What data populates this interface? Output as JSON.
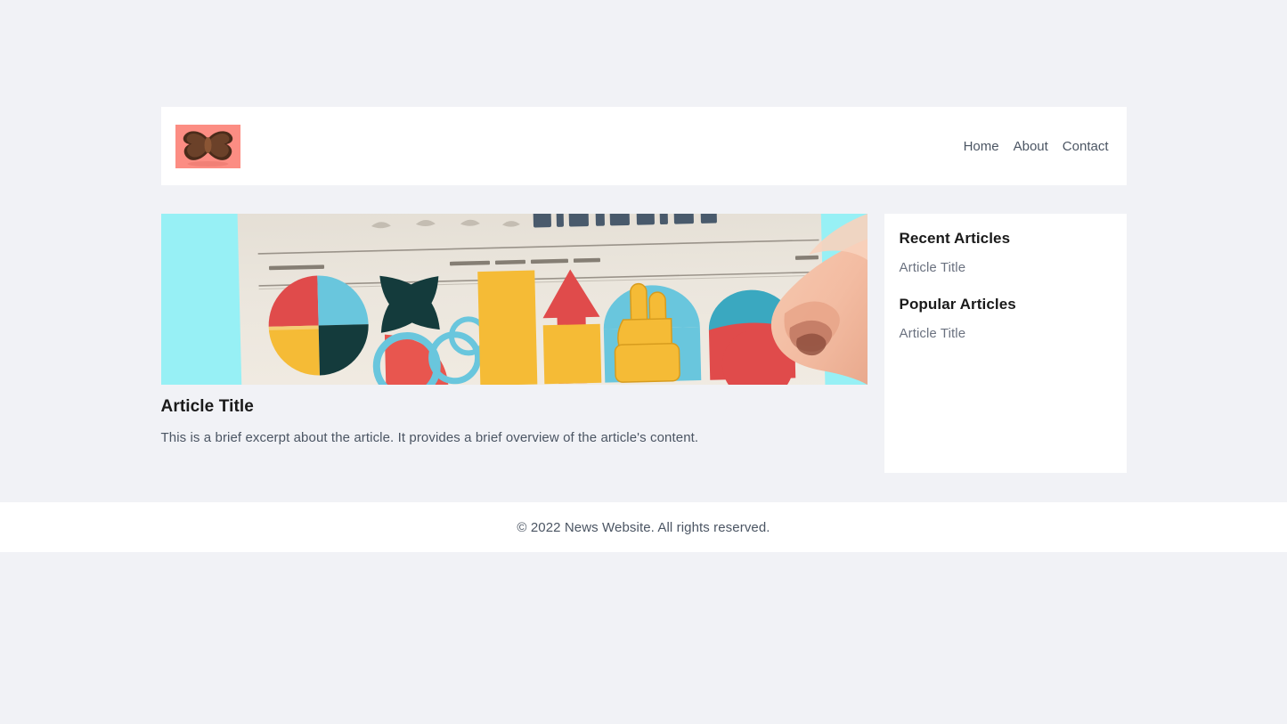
{
  "colors": {
    "page_background": "#f1f2f6",
    "surface": "#ffffff",
    "logo_background": "#fc8d83",
    "logo_mark": "#5a3522",
    "muted_text": "#4b5563",
    "sidebar_link": "#6b7280",
    "heading_text": "#1a1a1a",
    "hero_cyan": "#97f0f5"
  },
  "header": {
    "logo": {
      "icon": "butterfly-logo-icon",
      "alt": "News Website Logo"
    },
    "nav": [
      {
        "label": "Home",
        "name": "nav-link-home"
      },
      {
        "label": "About",
        "name": "nav-link-about"
      },
      {
        "label": "Contact",
        "name": "nav-link-contact"
      }
    ]
  },
  "main": {
    "featured_article": {
      "image_alt": "Hands holding a newspaper with colorful geometric shapes",
      "title": "Article Title",
      "excerpt": "This is a brief excerpt about the article. It provides a brief overview of the article's content."
    }
  },
  "sidebar": {
    "sections": [
      {
        "heading": "Recent Articles",
        "items": [
          {
            "label": "Article Title"
          }
        ]
      },
      {
        "heading": "Popular Articles",
        "items": [
          {
            "label": "Article Title"
          }
        ]
      }
    ]
  },
  "footer": {
    "copyright": "© 2022 News Website. All rights reserved."
  }
}
